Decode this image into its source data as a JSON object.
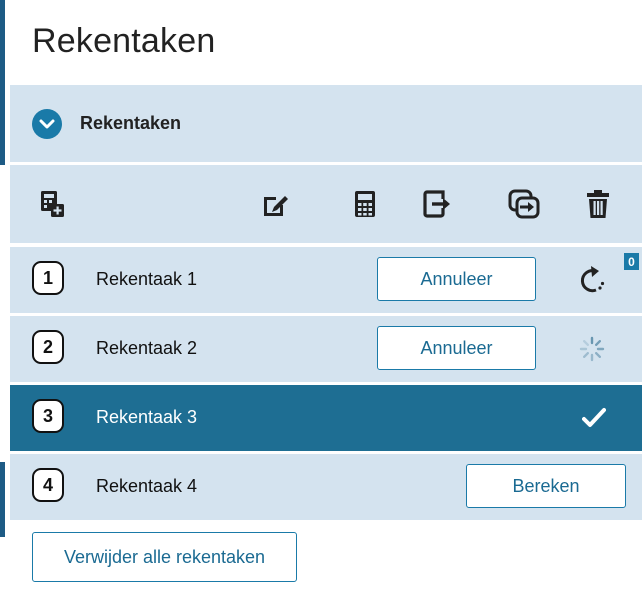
{
  "header": {
    "title": "Rekentaken"
  },
  "section": {
    "label": "Rekentaken",
    "icon": "chevron-down-icon"
  },
  "toolbar": {
    "icons": [
      "add-calculation-icon",
      "edit-icon",
      "calculator-icon",
      "export-icon",
      "copy-icon",
      "delete-icon"
    ]
  },
  "tasks": [
    {
      "number": "1",
      "label": "Rekentaak 1",
      "button": "Annuleer",
      "status": "queued",
      "badge": "0"
    },
    {
      "number": "2",
      "label": "Rekentaak 2",
      "button": "Annuleer",
      "status": "running"
    },
    {
      "number": "3",
      "label": "Rekentaak 3",
      "status": "done",
      "selected": true
    },
    {
      "number": "4",
      "label": "Rekentaak 4",
      "button": "Bereken",
      "status": "idle"
    }
  ],
  "footer": {
    "remove_all_label": "Verwijder alle rekentaken"
  },
  "colors": {
    "accent": "#1a7aa8",
    "selected": "#1e6e93",
    "panel": "#d4e3ef"
  }
}
